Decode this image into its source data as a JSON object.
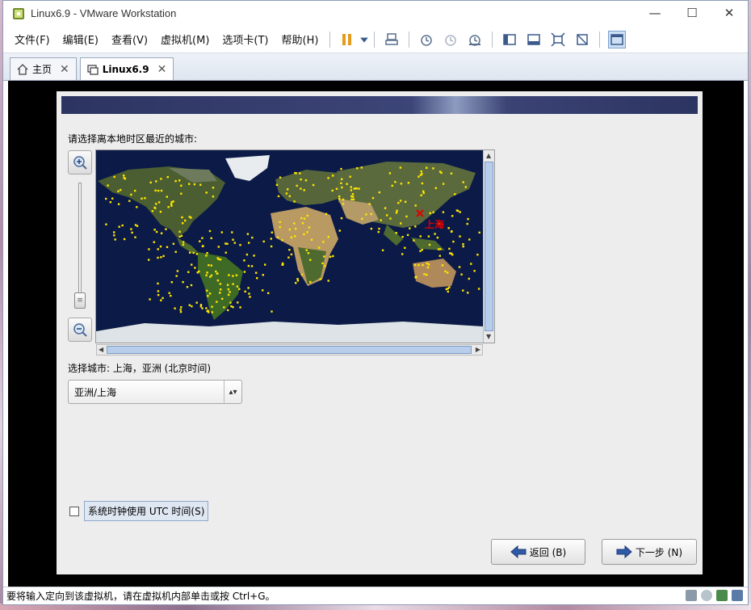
{
  "window": {
    "title": "Linux6.9 - VMware Workstation",
    "minimize": "—",
    "maximize": "☐",
    "close": "✕"
  },
  "menu": [
    "文件(F)",
    "编辑(E)",
    "查看(V)",
    "虚拟机(M)",
    "选项卡(T)",
    "帮助(H)"
  ],
  "tabs": [
    {
      "label": "主页",
      "close": "✕"
    },
    {
      "label": "Linux6.9",
      "close": "✕"
    }
  ],
  "installer": {
    "prompt": "请选择离本地时区最近的城市:",
    "map_city_label": "上海",
    "selected_city_text": "选择城市: 上海，亚洲 (北京时间)",
    "timezone_value": "亚洲/上海",
    "utc_label": "系统时钟使用 UTC 时间(S)",
    "utc_checked": false,
    "back_label": "返回 (B)",
    "next_label": "下一步 (N)"
  },
  "status": {
    "text": "要将输入定向到该虚拟机，请在虚拟机内部单击或按 Ctrl+G。"
  }
}
